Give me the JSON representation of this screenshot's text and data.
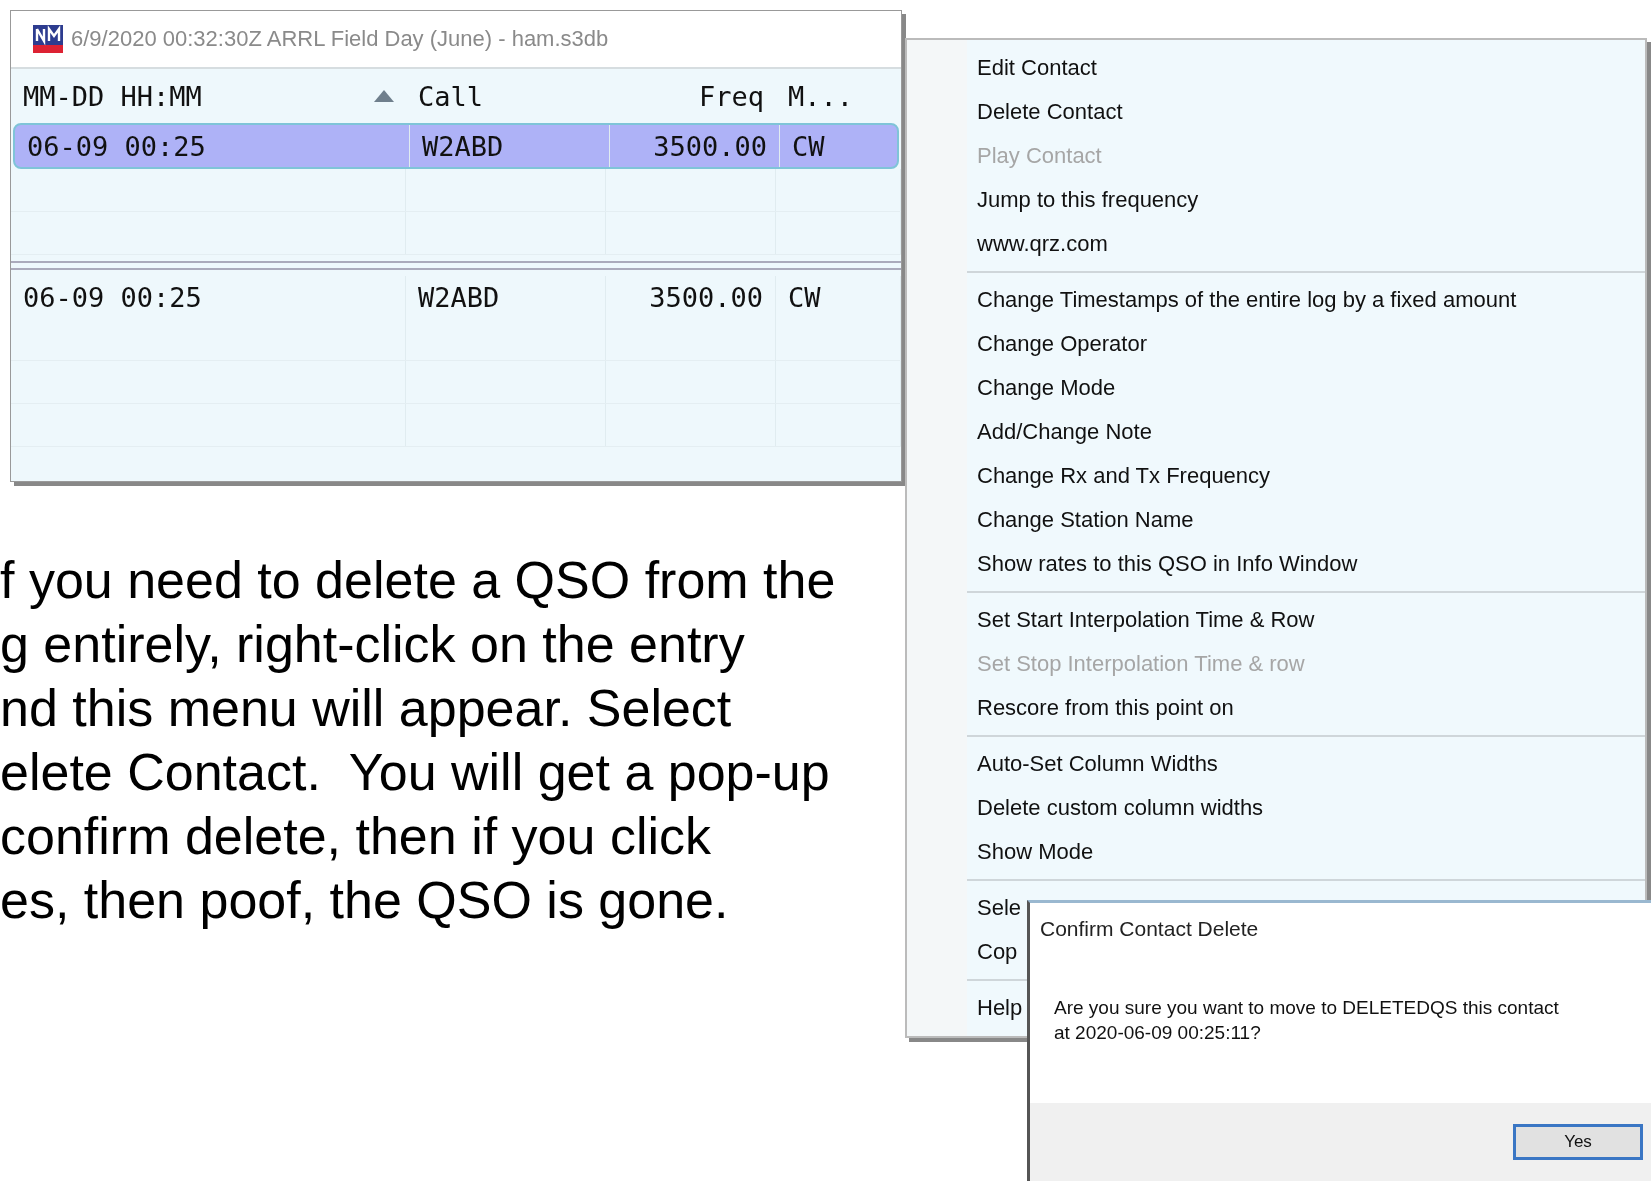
{
  "log_window": {
    "title": "6/9/2020 00:32:30Z  ARRL Field Day (June) - ham.s3db",
    "columns": [
      {
        "label": "MM-DD HH:MM",
        "sorted": true
      },
      {
        "label": "Call",
        "sorted": false
      },
      {
        "label": "Freq",
        "sorted": false
      },
      {
        "label": "M...",
        "sorted": false
      }
    ],
    "rows": [
      {
        "cells": [
          "06-09 00:25",
          "W2ABD",
          "3500.00",
          "CW"
        ],
        "selected": true
      }
    ],
    "lower_rows": [
      {
        "cells": [
          "06-09 00:25",
          "W2ABD",
          "3500.00",
          "CW"
        ],
        "selected": false
      }
    ]
  },
  "instructions": [
    "f you need to delete a QSO from the",
    "g entirely, right-click on the entry",
    "nd this menu will appear. Select",
    "elete Contact.  You will get a pop-up",
    "confirm delete, then if you click",
    "es, then poof, the QSO is gone."
  ],
  "context_menu": {
    "sections": [
      [
        {
          "label": "Edit Contact",
          "disabled": false
        },
        {
          "label": "Delete Contact",
          "disabled": false
        },
        {
          "label": "Play Contact",
          "disabled": true
        },
        {
          "label": "Jump to this frequency",
          "disabled": false
        },
        {
          "label": "www.qrz.com",
          "disabled": false
        }
      ],
      [
        {
          "label": "Change Timestamps of the entire log by a fixed amount",
          "disabled": false
        },
        {
          "label": "Change Operator",
          "disabled": false
        },
        {
          "label": "Change Mode",
          "disabled": false
        },
        {
          "label": "Add/Change Note",
          "disabled": false
        },
        {
          "label": "Change Rx and Tx Frequency",
          "disabled": false
        },
        {
          "label": "Change Station Name",
          "disabled": false
        },
        {
          "label": "Show rates to this QSO in Info Window",
          "disabled": false
        }
      ],
      [
        {
          "label": "Set Start Interpolation Time & Row",
          "disabled": false
        },
        {
          "label": "Set Stop Interpolation Time & row",
          "disabled": true
        },
        {
          "label": "Rescore from this point on",
          "disabled": false
        }
      ],
      [
        {
          "label": "Auto-Set Column Widths",
          "disabled": false
        },
        {
          "label": "Delete custom column widths",
          "disabled": false
        },
        {
          "label": "Show Mode",
          "disabled": false
        }
      ],
      [
        {
          "label": "Sele",
          "disabled": false
        },
        {
          "label": "Cop",
          "disabled": false
        }
      ],
      [
        {
          "label": "Help",
          "disabled": false
        }
      ]
    ]
  },
  "confirm_dialog": {
    "title": "Confirm Contact Delete",
    "message_lines": [
      "Are you sure you want to move to DELETEDQS this contact",
      "at 2020-06-09 00:25:11?"
    ],
    "buttons": [
      "Yes"
    ]
  }
}
